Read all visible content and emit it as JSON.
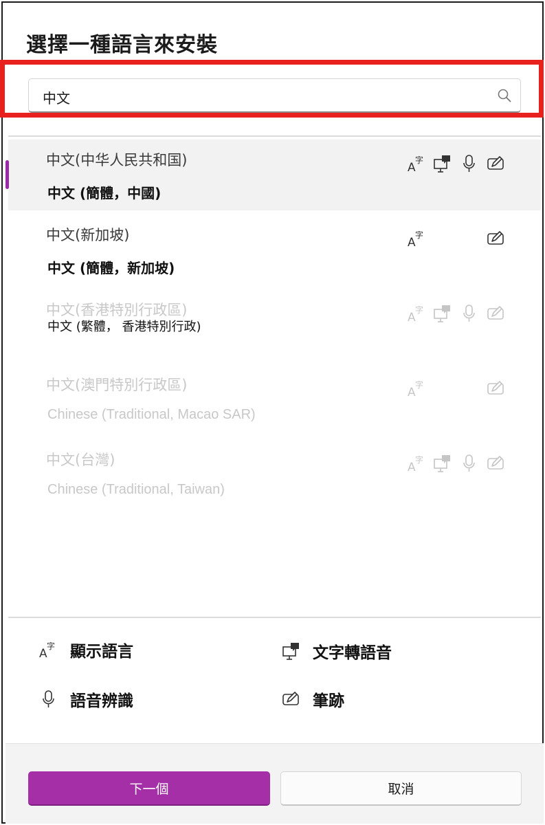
{
  "dialog": {
    "title": "選擇一種語言來安裝"
  },
  "search": {
    "value": "中文",
    "icon": "search-icon"
  },
  "languages": [
    {
      "name": "中文(中华人民共和国)",
      "subtitle": "中文 (簡體，中國)",
      "selected": true,
      "enabled": true,
      "features": [
        "display-language-icon",
        "text-to-speech-icon",
        "speech-recognition-icon",
        "handwriting-icon"
      ]
    },
    {
      "name": "中文(新加坡)",
      "subtitle": "中文 (簡體，新加坡)",
      "selected": false,
      "enabled": true,
      "features": [
        "display-language-icon",
        "handwriting-icon"
      ]
    },
    {
      "name": "中文(香港特別行政區)",
      "subtitle": "中文 (繁體，           香港特別行政)",
      "selected": false,
      "enabled": false,
      "features": [
        "display-language-icon",
        "text-to-speech-icon",
        "speech-recognition-icon",
        "handwriting-icon"
      ]
    },
    {
      "name": "中文(澳門特別行政區)",
      "subtitle": "Chinese (Traditional, Macao SAR)",
      "selected": false,
      "enabled": false,
      "features": [
        "display-language-icon",
        "handwriting-icon"
      ]
    },
    {
      "name": "中文(台灣)",
      "subtitle": "Chinese (Traditional, Taiwan)",
      "selected": false,
      "enabled": false,
      "features": [
        "display-language-icon",
        "text-to-speech-icon",
        "speech-recognition-icon",
        "handwriting-icon"
      ]
    }
  ],
  "legend": {
    "display_language": "顯示語言",
    "text_to_speech": "文字轉語音",
    "speech_recognition": "語音辨識",
    "handwriting": "筆跡"
  },
  "buttons": {
    "next": "下一個",
    "cancel": "取消"
  },
  "colors": {
    "accent": "#a42fa7",
    "highlight_frame": "#e8201e",
    "disabled_text": "#c8c8c8"
  }
}
